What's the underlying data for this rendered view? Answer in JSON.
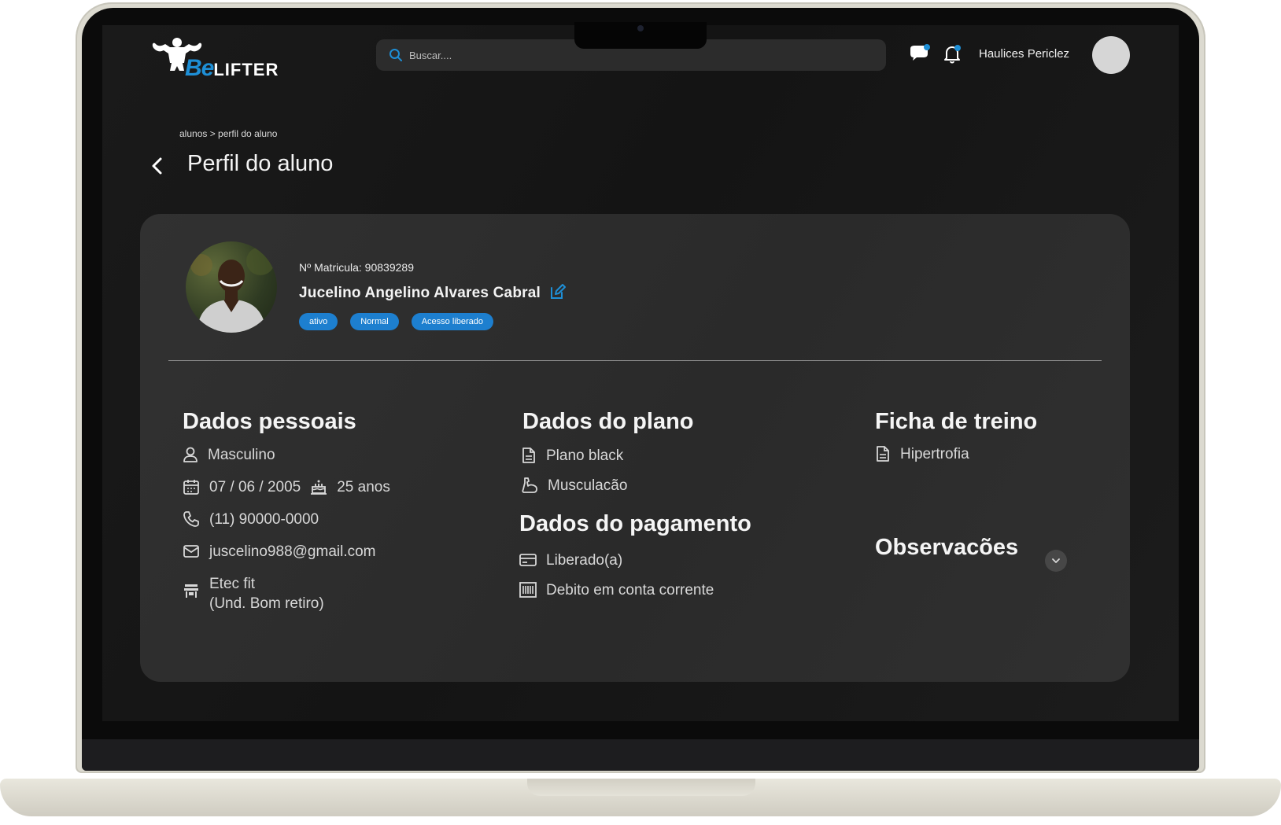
{
  "header": {
    "brand_be": "Be",
    "brand_lifter": "LIFTER",
    "search_placeholder": "Buscar....",
    "user_name": "Haulices Periclez"
  },
  "breadcrumb": "alunos > perfil do aluno",
  "page_title": "Perfil do aluno",
  "student": {
    "matricula": "Nº Matricula: 90839289",
    "name": "Jucelino Angelino Alvares Cabral",
    "badges": [
      "ativo",
      "Normal",
      "Acesso liberado"
    ]
  },
  "personal": {
    "title": "Dados pessoais",
    "gender": "Masculino",
    "birthdate": "07 / 06 / 2005",
    "age": "25 anos",
    "phone": "(11) 90000-0000",
    "email": "juscelino988@gmail.com",
    "unit_line1": "Etec fit",
    "unit_line2": "(Und. Bom retiro)"
  },
  "plan": {
    "title": "Dados do plano",
    "plan_name": "Plano black",
    "modality": "Musculacão"
  },
  "payment": {
    "title": "Dados do pagamento",
    "status": "Liberado(a)",
    "method": "Debito em conta corrente"
  },
  "training": {
    "title": "Ficha de treino",
    "sheet": "Hipertrofia"
  },
  "observations": {
    "title": "Observacões"
  },
  "colors": {
    "accent": "#1d7fcf",
    "background": "#161616",
    "card": "#2e2e2e"
  }
}
